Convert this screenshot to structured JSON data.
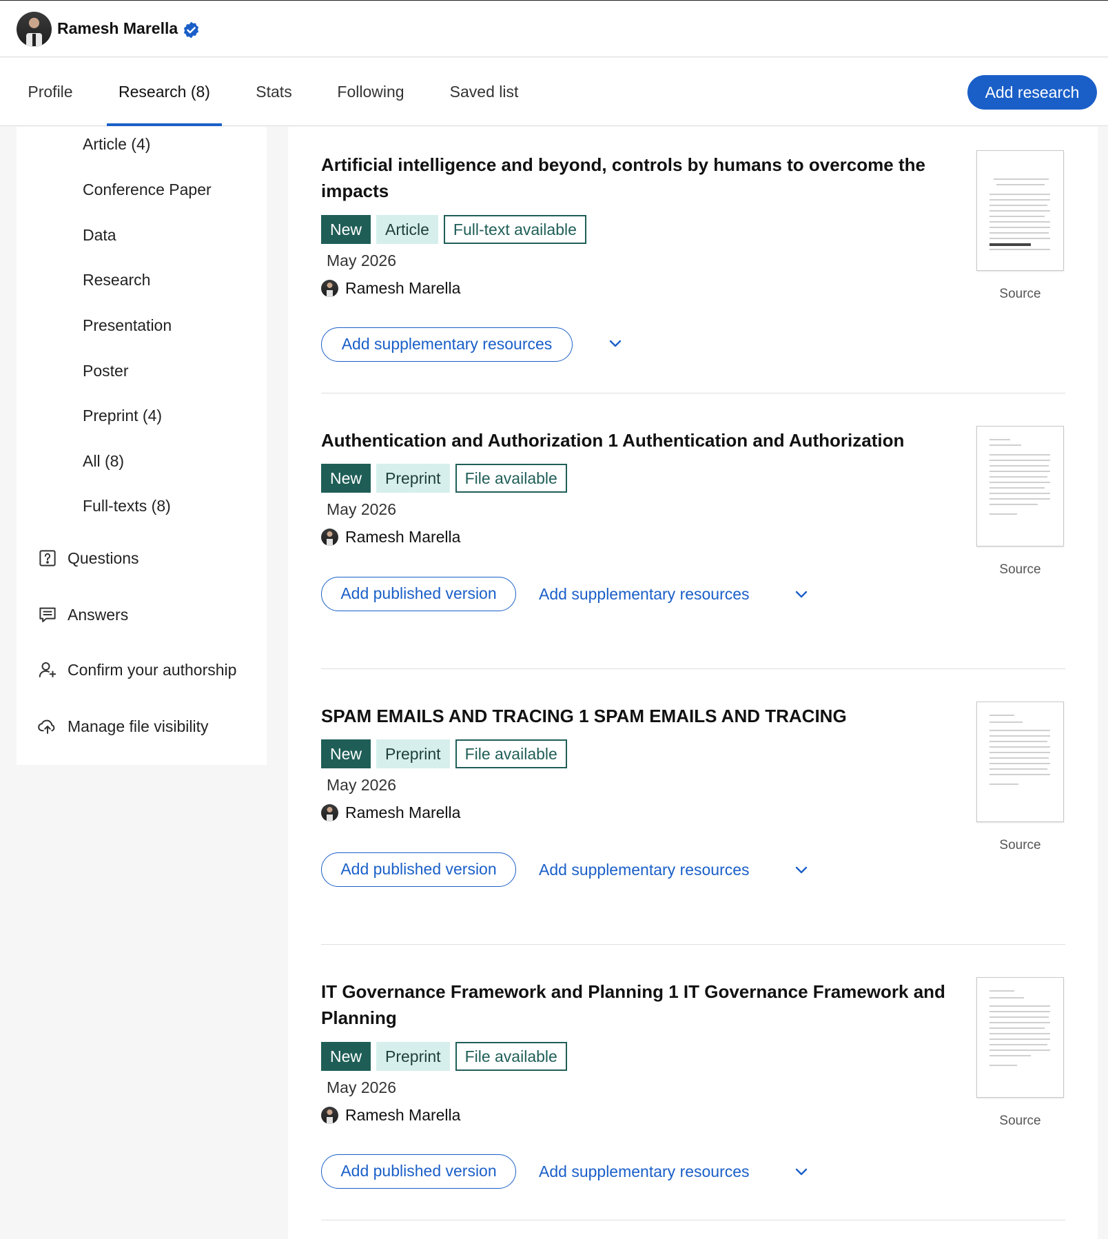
{
  "user": {
    "name": "Ramesh Marella"
  },
  "tabs": [
    {
      "label": "Profile"
    },
    {
      "label": "Research (8)"
    },
    {
      "label": "Stats"
    },
    {
      "label": "Following"
    },
    {
      "label": "Saved list"
    }
  ],
  "add_research_label": "Add research",
  "sidebar": {
    "types": [
      "Article (4)",
      "Conference Paper",
      "Data",
      "Research",
      "Presentation",
      "Poster",
      "Preprint (4)",
      "All (8)",
      "Full-texts (8)"
    ],
    "links": [
      {
        "label": "Questions",
        "icon": "question-icon"
      },
      {
        "label": "Answers",
        "icon": "answers-icon"
      },
      {
        "label": "Confirm your authorship",
        "icon": "user-plus-icon"
      },
      {
        "label": "Manage file visibility",
        "icon": "cloud-upload-icon"
      }
    ]
  },
  "items": [
    {
      "title": "Artificial intelligence and beyond, controls by humans to overcome the impacts",
      "tags": {
        "new": "New",
        "type": "Article",
        "availability": "Full-text available"
      },
      "date": "May 2026",
      "author": "Ramesh Marella",
      "published_label": "",
      "supplementary_label": "Add supplementary resources",
      "source_label": "Source"
    },
    {
      "title": "Authentication and Authorization 1 Authentication and Authorization",
      "tags": {
        "new": "New",
        "type": "Preprint",
        "availability": "File available"
      },
      "date": "May 2026",
      "author": "Ramesh Marella",
      "published_label": "Add published version",
      "supplementary_label": "Add supplementary resources",
      "source_label": "Source"
    },
    {
      "title": "SPAM EMAILS AND TRACING 1 SPAM EMAILS AND TRACING",
      "tags": {
        "new": "New",
        "type": "Preprint",
        "availability": "File available"
      },
      "date": "May 2026",
      "author": "Ramesh Marella",
      "published_label": "Add published version",
      "supplementary_label": "Add supplementary resources",
      "source_label": "Source"
    },
    {
      "title": "IT Governance Framework and Planning 1 IT Governance Framework and Planning",
      "tags": {
        "new": "New",
        "type": "Preprint",
        "availability": "File available"
      },
      "date": "May 2026",
      "author": "Ramesh Marella",
      "published_label": "Add published version",
      "supplementary_label": "Add supplementary resources",
      "source_label": "Source"
    }
  ],
  "colors": {
    "accent": "#1a5fc8",
    "tag_new": "#1f5e57",
    "tag_type": "#d6efec"
  }
}
